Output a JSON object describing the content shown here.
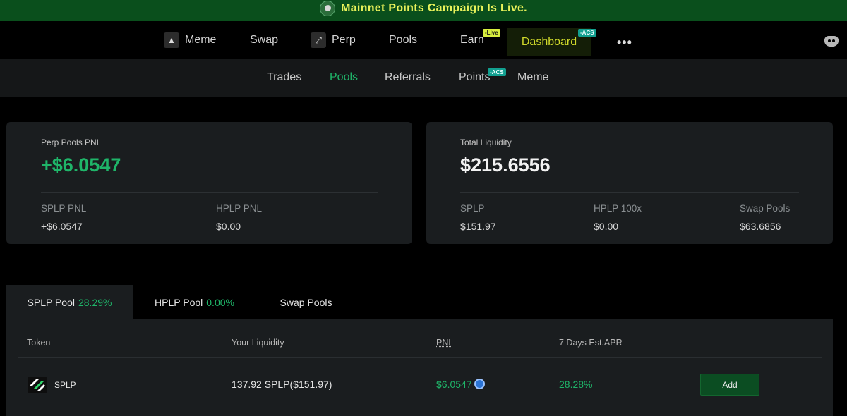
{
  "banner": {
    "text": "Mainnet Points Campaign Is Live."
  },
  "nav": {
    "meme": "Meme",
    "swap": "Swap",
    "perp": "Perp",
    "pools": "Pools",
    "earn": "Earn",
    "earn_badge": "-Live",
    "dashboard": "Dashboard",
    "dashboard_badge": "-ACS",
    "more": "•••"
  },
  "subnav": {
    "trades": "Trades",
    "pools": "Pools",
    "referrals": "Referrals",
    "points": "Points",
    "points_badge": "-ACS",
    "meme": "Meme"
  },
  "pnl_card": {
    "label": "Perp Pools PNL",
    "value": "+$6.0547",
    "splp_label": "SPLP PNL",
    "splp_value": "+$6.0547",
    "hplp_label": "HPLP PNL",
    "hplp_value": "$0.00"
  },
  "liquidity_card": {
    "label": "Total Liquidity",
    "value": "$215.6556",
    "splp_label": "SPLP",
    "splp_value": "$151.97",
    "hplp_label": "HPLP 100x",
    "hplp_value": "$0.00",
    "swap_label": "Swap Pools",
    "swap_value": "$63.6856"
  },
  "tabs": {
    "splp_label": "SPLP Pool",
    "splp_pct": "28.29%",
    "hplp_label": "HPLP Pool",
    "hplp_pct": "0.00%",
    "swap_label": "Swap Pools"
  },
  "table": {
    "headers": {
      "token": "Token",
      "liquidity": "Your Liquidity",
      "pnl": "PNL",
      "apr": "7 Days Est.APR"
    },
    "row": {
      "token": "SPLP",
      "liquidity": "137.92 SPLP($151.97)",
      "pnl": "$6.0547",
      "apr": "28.28%",
      "action": "Add"
    }
  },
  "colors": {
    "accent_green": "#1fb569",
    "banner_bg": "#0a4f1c",
    "banner_text": "#e8f25a",
    "card_bg": "#1a1d1f"
  }
}
